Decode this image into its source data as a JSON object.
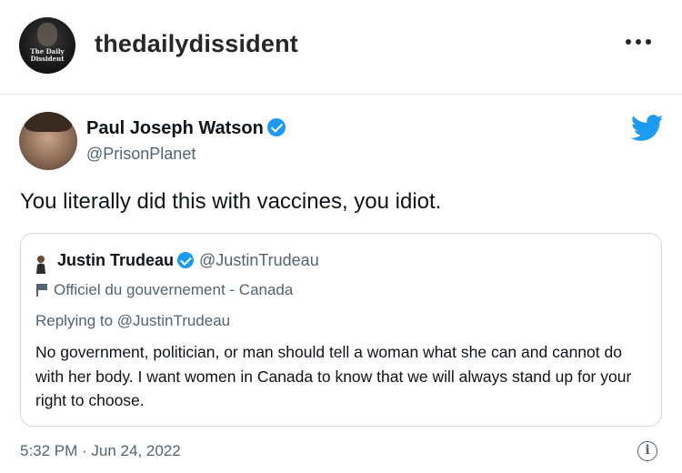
{
  "instagram": {
    "username": "thedailydissident",
    "avatar_text": "The Daily Dissident",
    "more_icon": "more-horizontal-icon"
  },
  "tweet": {
    "author_name": "Paul Joseph Watson",
    "author_handle": "@PrisonPlanet",
    "text": "You literally did this with vaccines, you idiot.",
    "timestamp": "5:32 PM · Jun 24, 2022",
    "brand_color": "#1d9bf0",
    "quoted": {
      "author_name": "Justin Trudeau",
      "author_handle": "@JustinTrudeau",
      "affiliation": "Officiel du gouvernement - Canada",
      "replying_to": "Replying to @JustinTrudeau",
      "body": "No government, politician, or man should tell a woman what she can and cannot do with her body. I want women in Canada to know that we will always stand up for your right to choose."
    }
  }
}
